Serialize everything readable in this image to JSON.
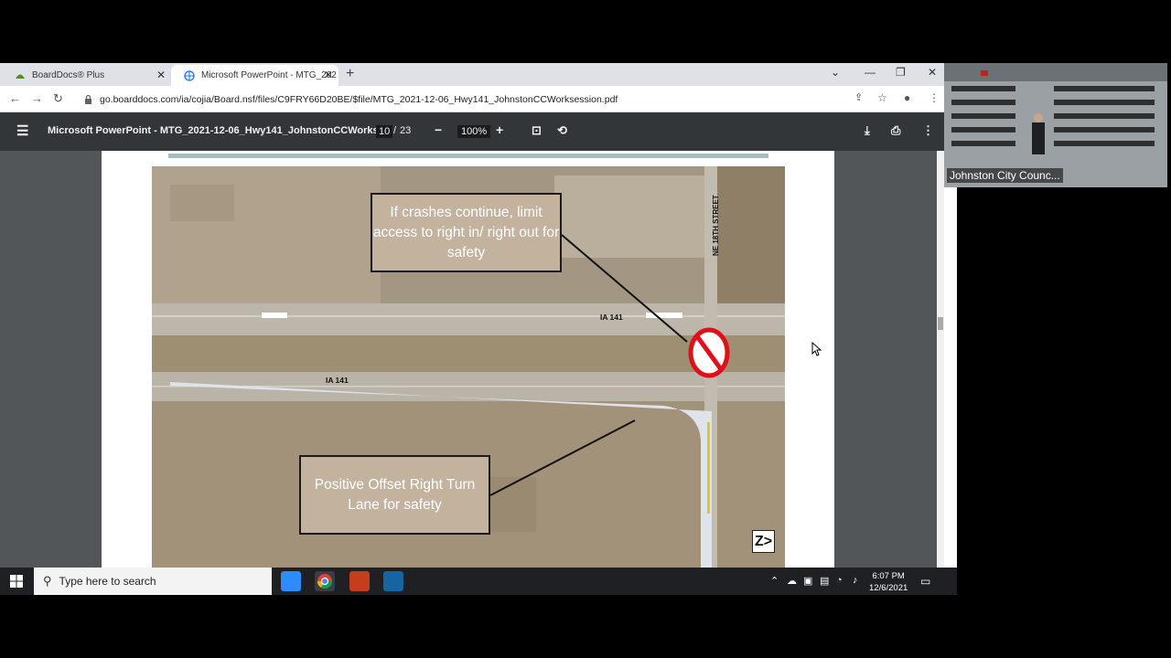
{
  "browser": {
    "tabs": [
      {
        "label": "BoardDocs® Plus"
      },
      {
        "label": "Microsoft PowerPoint - MTG_202"
      }
    ],
    "url": "go.boarddocs.com/ia/cojia/Board.nsf/files/C9FRY66D20BE/$file/MTG_2021-12-06_Hwy141_JohnstonCCWorksession.pdf"
  },
  "pdf": {
    "title": "Microsoft PowerPoint - MTG_2021-12-06_Hwy141_JohnstonCCWorks...",
    "page_current": "10",
    "page_sep": "/",
    "page_total": "23",
    "zoom": "100%"
  },
  "slide": {
    "callout_top": "If crashes continue, limit access to right in/ right out for safety",
    "callout_bottom": "Positive Offset Right Turn Lane for safety",
    "street_label": "NE 18TH STREET",
    "road_label_upper": "IA 141",
    "road_label_lower": "IA 141",
    "logo": "Z>"
  },
  "webcam": {
    "label": "Johnston City Counc..."
  },
  "taskbar": {
    "search_placeholder": "Type here to search",
    "time": "6:07 PM",
    "date": "12/6/2021"
  },
  "colors": {
    "pdf_toolbar": "#323639",
    "pdf_background": "#525659",
    "callout_fill": "#c2b29e",
    "no_sign_red": "#e0101a",
    "taskbar": "#1f2024"
  }
}
